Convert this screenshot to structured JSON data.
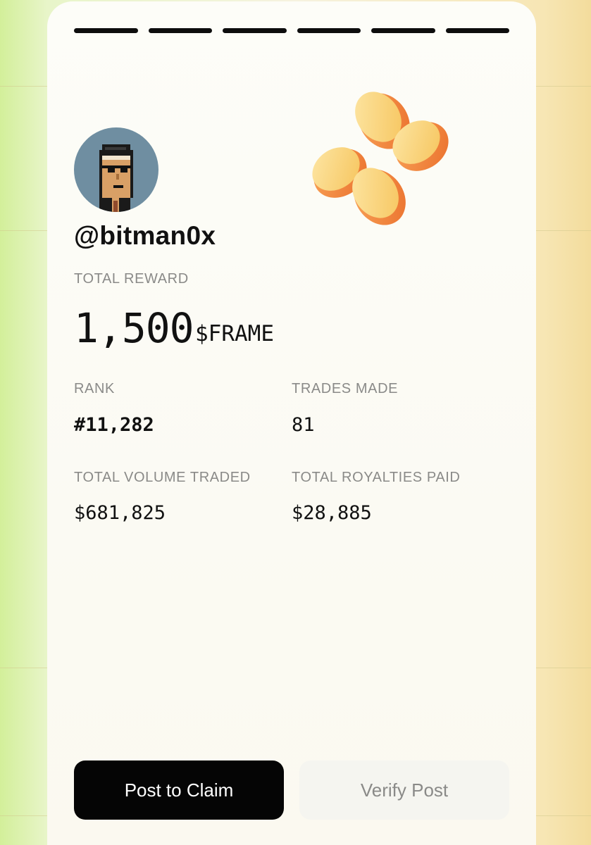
{
  "profile": {
    "handle": "@bitman0x",
    "avatar_icon": "pixel-punk-avatar",
    "avatar_bg": "#6f8ea1"
  },
  "progress": {
    "total_steps": 6,
    "completed_steps": 6,
    "color": "#0d0d0d"
  },
  "brand": {
    "logo_icon": "four-petal-logo"
  },
  "reward": {
    "label": "TOTAL REWARD",
    "amount": "1,500",
    "unit": "$FRAME"
  },
  "stats": {
    "rank": {
      "label": "RANK",
      "value": "#11,282"
    },
    "trades": {
      "label": "TRADES MADE",
      "value": "81"
    },
    "volume": {
      "label": "TOTAL VOLUME TRADED",
      "value": "$681,825"
    },
    "royalties": {
      "label": "TOTAL ROYALTIES PAID",
      "value": "$28,885"
    }
  },
  "actions": {
    "post_to_claim": "Post to Claim",
    "verify_post": "Verify Post"
  },
  "colors": {
    "primary_button": "#050505",
    "secondary_button": "#f5f5f0",
    "muted_text": "#8a8a88"
  }
}
